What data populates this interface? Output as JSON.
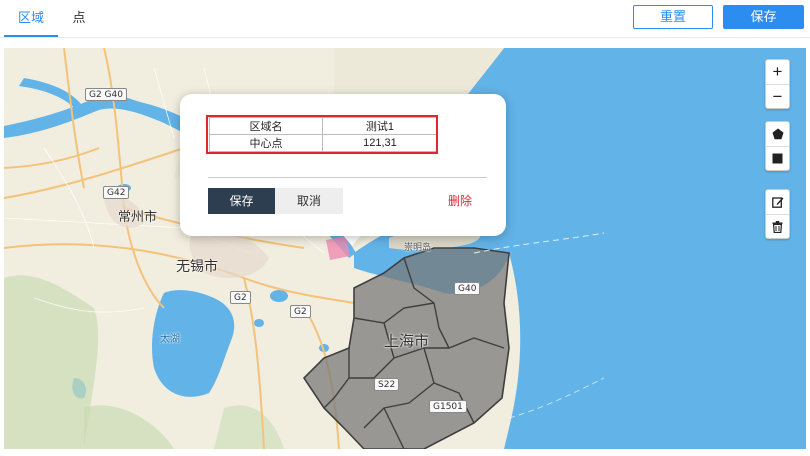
{
  "tabs": [
    {
      "label": "区域",
      "active": true
    },
    {
      "label": "点",
      "active": false
    }
  ],
  "toolbar": {
    "reset_label": "重置",
    "save_label": "保存"
  },
  "map": {
    "places": [
      {
        "id": "changzhou",
        "label": "常州市"
      },
      {
        "id": "wuxi",
        "label": "无锡市"
      },
      {
        "id": "shanghai",
        "label": "上海市"
      },
      {
        "id": "taihu",
        "label": "太湖"
      },
      {
        "id": "chongming",
        "label": "崇明岛"
      }
    ],
    "road_shields": [
      {
        "id": "g2g40",
        "label": "G2 G40"
      },
      {
        "id": "g42",
        "label": "G42"
      },
      {
        "id": "g2a",
        "label": "G2"
      },
      {
        "id": "g2b",
        "label": "G2"
      },
      {
        "id": "g40",
        "label": "G40"
      },
      {
        "id": "s22",
        "label": "S22"
      },
      {
        "id": "g1501",
        "label": "G1501"
      }
    ],
    "colors": {
      "land": "#f1eddf",
      "water": "#62b3e8",
      "region_fill": "#7a7a7a",
      "region_border": "#3f3f3f"
    }
  },
  "controls": {
    "zoom_in": "+",
    "zoom_out": "−",
    "tools": [
      "polygon-icon",
      "square-icon",
      "edit-icon",
      "trash-icon"
    ]
  },
  "popup": {
    "rows": [
      {
        "key": "区域名",
        "value": "测试1"
      },
      {
        "key": "中心点",
        "value": "121,31"
      }
    ],
    "save_label": "保存",
    "cancel_label": "取消",
    "delete_label": "删除"
  }
}
